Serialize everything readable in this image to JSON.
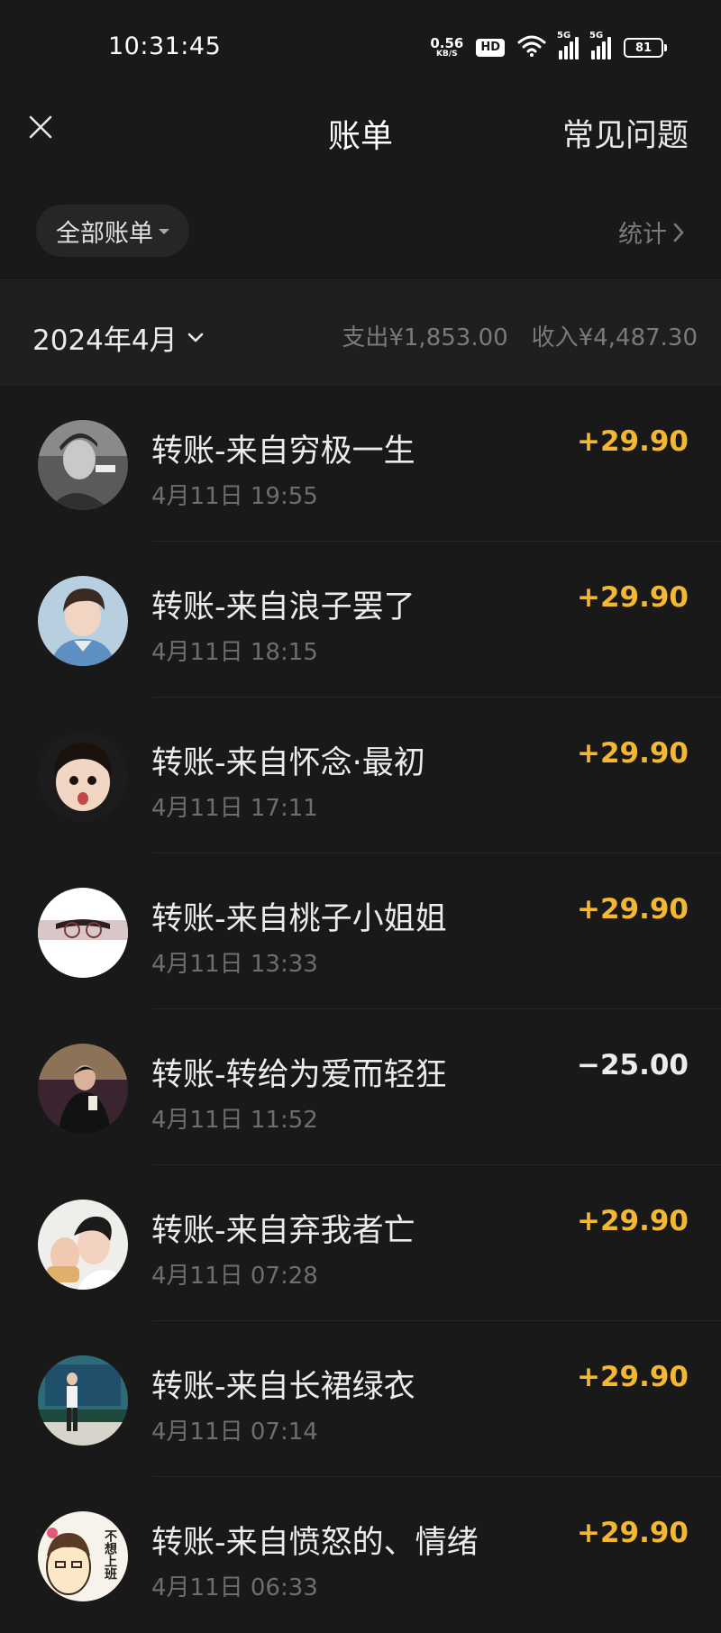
{
  "status_bar": {
    "time": "10:31:45",
    "net_speed": "0.56",
    "net_unit": "KB/S",
    "hd_label": "HD",
    "signal_1_label": "5G",
    "signal_2_label": "5G",
    "battery": "81"
  },
  "nav": {
    "title": "账单",
    "faq_label": "常见问题"
  },
  "filter": {
    "selected": "全部账单",
    "stats_label": "统计"
  },
  "month": {
    "label": "2024年4月",
    "expense": "支出¥1,853.00",
    "income": "收入¥4,487.30"
  },
  "transactions": [
    {
      "title": "转账-来自穷极一生",
      "datetime": "4月11日 19:55",
      "amount": "+29.90",
      "direction": "in"
    },
    {
      "title": "转账-来自浪子罢了",
      "datetime": "4月11日 18:15",
      "amount": "+29.90",
      "direction": "in"
    },
    {
      "title": "转账-来自怀念·最初",
      "datetime": "4月11日 17:11",
      "amount": "+29.90",
      "direction": "in"
    },
    {
      "title": "转账-来自桃子小姐姐",
      "datetime": "4月11日 13:33",
      "amount": "+29.90",
      "direction": "in"
    },
    {
      "title": "转账-转给为爱而轻狂",
      "datetime": "4月11日 11:52",
      "amount": "−25.00",
      "direction": "out"
    },
    {
      "title": "转账-来自弃我者亡",
      "datetime": "4月11日 07:28",
      "amount": "+29.90",
      "direction": "in"
    },
    {
      "title": "转账-来自长裙绿衣",
      "datetime": "4月11日 07:14",
      "amount": "+29.90",
      "direction": "in"
    },
    {
      "title": "转账-来自愤怒的、情绪",
      "datetime": "4月11日 06:33",
      "amount": "+29.90",
      "direction": "in"
    }
  ],
  "avatar_labels": {
    "sign_text": "不想上班"
  },
  "colors": {
    "background": "#191919",
    "income": "#f4b731",
    "expense": "#ececec",
    "muted": "#6e6e6e"
  }
}
